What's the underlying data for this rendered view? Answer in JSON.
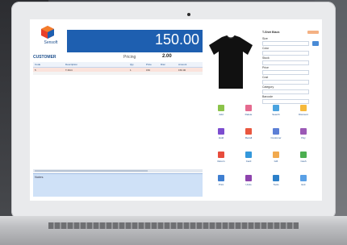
{
  "app": {
    "brand": "Sensoft",
    "total": "150.00"
  },
  "sale": {
    "customer": "CUSTOMER",
    "pricing_label": "Pricing",
    "pricing_value": "2.00",
    "columns": [
      "Code",
      "Description",
      "Qty",
      "Price",
      "Disc",
      "Amount"
    ],
    "rows": [
      {
        "code": "5",
        "description": "T-Shirt",
        "qty": "1",
        "price": "150",
        "disc": "",
        "amount": "150.00"
      }
    ],
    "notes_label": "Notes"
  },
  "product": {
    "name": "T-Shirt Black",
    "fields": [
      "Size",
      "Color",
      "Stock",
      "Price",
      "Cost",
      "Category",
      "Barcode"
    ]
  },
  "actions": [
    {
      "label": "Add",
      "color": "#8bc34a"
    },
    {
      "label": "Delete",
      "color": "#e56a8f"
    },
    {
      "label": "Search",
      "color": "#4aa3df"
    },
    {
      "label": "Discount",
      "color": "#f6b93b"
    },
    {
      "label": "Hold",
      "color": "#7c4dcf"
    },
    {
      "label": "Recall",
      "color": "#e9573f"
    },
    {
      "label": "Customer",
      "color": "#5c7fd6"
    },
    {
      "label": "Pay",
      "color": "#9b59b6"
    },
    {
      "label": "Return",
      "color": "#e74c3c"
    },
    {
      "label": "Card",
      "color": "#3498db"
    },
    {
      "label": "Gift",
      "color": "#f1a94e"
    },
    {
      "label": "Cash",
      "color": "#4caf50"
    },
    {
      "label": "Print",
      "color": "#3f7fd1"
    },
    {
      "label": "Undo",
      "color": "#8e44ad"
    },
    {
      "label": "Tools",
      "color": "#2c80c9"
    },
    {
      "label": "Exit",
      "color": "#5aa0e6"
    }
  ]
}
